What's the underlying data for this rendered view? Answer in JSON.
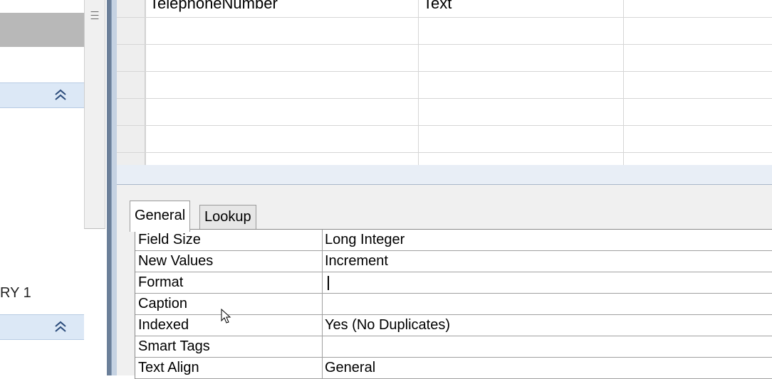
{
  "nav_pane": {
    "item_label": "RY 1",
    "collapse_icon_1": "double-chevron-up-icon",
    "collapse_icon_2": "double-chevron-up-icon"
  },
  "design_grid": {
    "rows": [
      {
        "field_name": "TelephoneNumber",
        "data_type": "Text"
      }
    ]
  },
  "properties": {
    "tabs": [
      {
        "label": "General",
        "active": true
      },
      {
        "label": "Lookup",
        "active": false
      }
    ],
    "rows": [
      {
        "label": "Field Size",
        "value": "Long Integer"
      },
      {
        "label": "New Values",
        "value": "Increment"
      },
      {
        "label": "Format",
        "value": ""
      },
      {
        "label": "Caption",
        "value": ""
      },
      {
        "label": "Indexed",
        "value": "Yes (No Duplicates)"
      },
      {
        "label": "Smart Tags",
        "value": ""
      },
      {
        "label": "Text Align",
        "value": "General"
      }
    ]
  },
  "colors": {
    "group_header": "#dce8f6",
    "frame": "#6b7f99"
  }
}
